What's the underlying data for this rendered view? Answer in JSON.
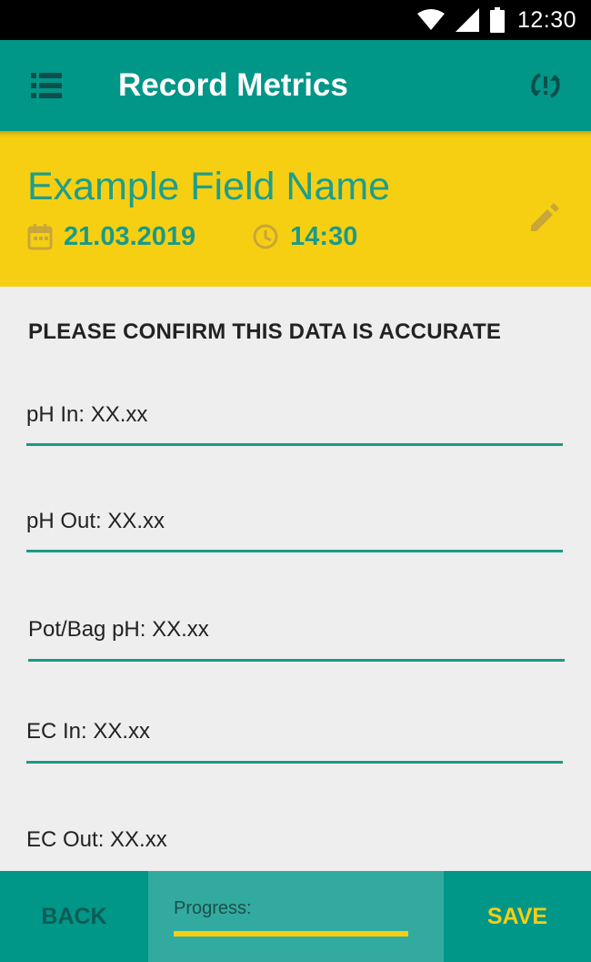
{
  "status_bar": {
    "time": "12:30",
    "icons": [
      "wifi-icon",
      "signal-icon",
      "battery-icon"
    ]
  },
  "app_bar": {
    "title": "Record Metrics",
    "menu_icon": "list-icon",
    "action_icon": "sync-problem-icon"
  },
  "header": {
    "field_name": "Example Field Name",
    "date": "21.03.2019",
    "time": "14:30",
    "date_icon": "calendar-icon",
    "time_icon": "clock-icon",
    "edit_icon": "pencil-icon"
  },
  "form": {
    "heading": "PLEASE CONFIRM THIS DATA IS ACCURATE",
    "fields": [
      {
        "text": "pH In: XX.xx"
      },
      {
        "text": "pH Out: XX.xx"
      },
      {
        "text": "Pot/Bag pH: XX.xx"
      },
      {
        "text": "EC In: XX.xx"
      },
      {
        "text": "EC Out: XX.xx"
      }
    ]
  },
  "bottom_bar": {
    "back_label": "BACK",
    "progress_label": "Progress:",
    "progress_value": 1.0,
    "save_label": "SAVE"
  },
  "colors": {
    "primary": "#009688",
    "accent": "#f6cf12",
    "teal_text": "#1a9a88",
    "background": "#eeeeee"
  }
}
